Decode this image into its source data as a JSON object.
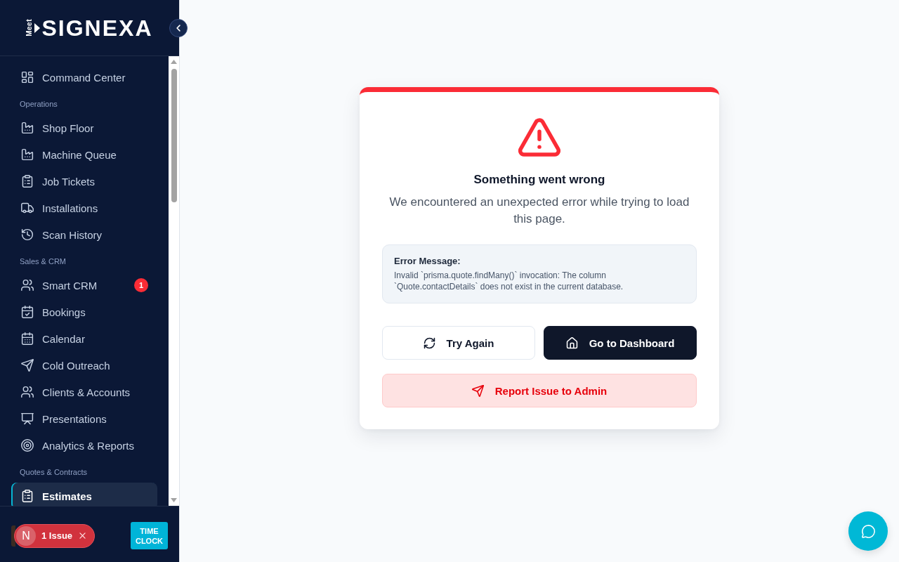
{
  "sidebar": {
    "logo": {
      "prefix": "Meet",
      "name": "SIGNEXA"
    },
    "sections": [
      {
        "items": [
          {
            "label": "Command Center",
            "selected": false
          }
        ]
      },
      {
        "title": "Operations",
        "items": [
          {
            "label": "Shop Floor",
            "selected": false
          },
          {
            "label": "Machine Queue",
            "selected": false
          },
          {
            "label": "Job Tickets",
            "selected": false
          },
          {
            "label": "Installations",
            "selected": false
          },
          {
            "label": "Scan History",
            "selected": false
          }
        ]
      },
      {
        "title": "Sales & CRM",
        "items": [
          {
            "label": "Smart CRM",
            "selected": false,
            "badge": "1"
          },
          {
            "label": "Bookings",
            "selected": false
          },
          {
            "label": "Calendar",
            "selected": false
          },
          {
            "label": "Cold Outreach",
            "selected": false
          },
          {
            "label": "Clients & Accounts",
            "selected": false
          },
          {
            "label": "Presentations",
            "selected": false
          },
          {
            "label": "Analytics & Reports",
            "selected": false
          }
        ]
      },
      {
        "title": "Quotes & Contracts",
        "items": [
          {
            "label": "Estimates",
            "selected": true
          }
        ]
      }
    ],
    "issue_indicator": {
      "letter": "N",
      "label": "1 Issue"
    },
    "time_clock": {
      "label": "TIME CLOCK"
    }
  },
  "error_card": {
    "title": "Something went wrong",
    "message": "We encountered an unexpected error while trying to load this page.",
    "details": {
      "label": "Error Message:",
      "text": "Invalid `prisma.quote.findMany()` invocation: The column `Quote.contactDetails` does not exist in the current database."
    },
    "buttons": [
      {
        "label": "Try Again",
        "kind": "secondary"
      },
      {
        "label": "Go to Dashboard",
        "kind": "primary"
      },
      {
        "label": "Report Issue to Admin",
        "kind": "danger"
      }
    ]
  }
}
